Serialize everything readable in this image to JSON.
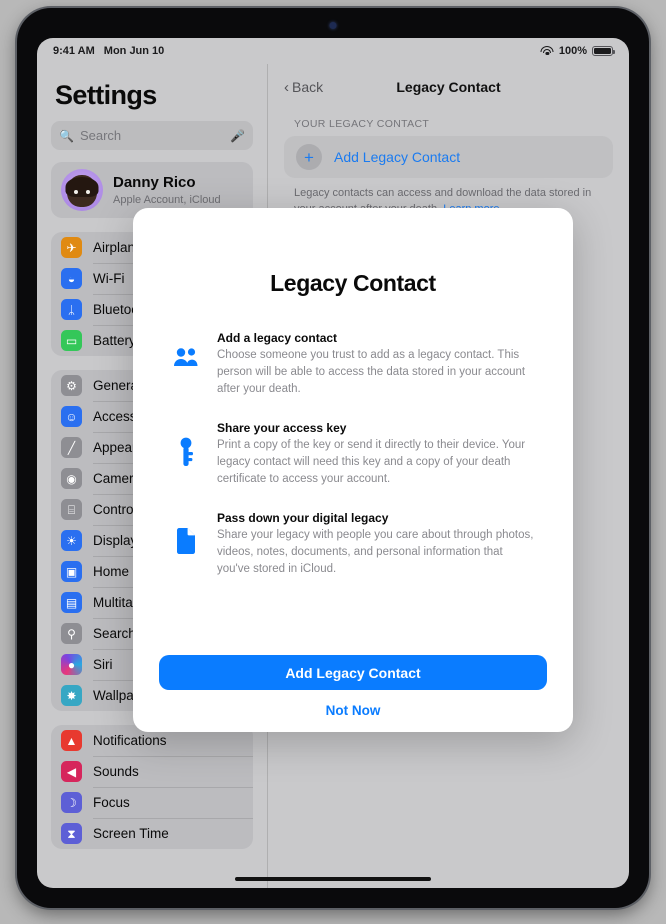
{
  "status_bar": {
    "time": "9:41 AM",
    "date": "Mon Jun 10",
    "wifi_icon": "wifi-icon",
    "battery_percent": "100%",
    "battery_icon": "battery-full-icon"
  },
  "sidebar": {
    "title": "Settings",
    "search": {
      "placeholder": "Search",
      "icon": "search-icon",
      "mic_icon": "microphone-icon"
    },
    "account": {
      "name": "Danny Rico",
      "subtitle": "Apple Account, iCloud",
      "avatar": "memoji-avatar"
    },
    "groups": [
      {
        "items": [
          {
            "label": "Airplane Mode",
            "icon": "airplane-icon",
            "color": "#e08a12"
          },
          {
            "label": "Wi-Fi",
            "icon": "wifi-icon",
            "color": "#2a6ff0"
          },
          {
            "label": "Bluetooth",
            "icon": "bluetooth-icon",
            "color": "#2a6ff0"
          },
          {
            "label": "Battery",
            "icon": "battery-icon",
            "color": "#34c759"
          }
        ]
      },
      {
        "items": [
          {
            "label": "General",
            "icon": "gear-icon",
            "color": "#8e8e93"
          },
          {
            "label": "Accessibility",
            "icon": "accessibility-icon",
            "color": "#2a6ff0"
          },
          {
            "label": "Appearance",
            "icon": "appearance-icon",
            "color": "#8e8e93"
          },
          {
            "label": "Camera",
            "icon": "camera-icon",
            "color": "#8e8e93"
          },
          {
            "label": "Control Center",
            "icon": "control-center-icon",
            "color": "#8e8e93"
          },
          {
            "label": "Display & Brightness",
            "icon": "brightness-icon",
            "color": "#2a6ff0"
          },
          {
            "label": "Home Screen & App Library",
            "icon": "home-screen-icon",
            "color": "#2a6ff0"
          },
          {
            "label": "Multitasking & Gestures",
            "icon": "multitasking-icon",
            "color": "#2a6ff0"
          },
          {
            "label": "Search",
            "icon": "search-icon",
            "color": "#8e8e93"
          },
          {
            "label": "Siri",
            "icon": "siri-icon",
            "color": "#2b2b35"
          },
          {
            "label": "Wallpaper",
            "icon": "wallpaper-icon",
            "color": "#37a7c4"
          }
        ]
      },
      {
        "items": [
          {
            "label": "Notifications",
            "icon": "bell-icon",
            "color": "#e8392f"
          },
          {
            "label": "Sounds",
            "icon": "speaker-icon",
            "color": "#d6265c"
          },
          {
            "label": "Focus",
            "icon": "moon-icon",
            "color": "#5d5fd6"
          },
          {
            "label": "Screen Time",
            "icon": "hourglass-icon",
            "color": "#5d5fd6"
          }
        ]
      }
    ]
  },
  "detail": {
    "back_label": "Back",
    "back_icon": "chevron-left-icon",
    "title": "Legacy Contact",
    "section_header": "YOUR LEGACY CONTACT",
    "add_row": {
      "label": "Add Legacy Contact",
      "icon": "plus-icon"
    },
    "footnote": "Legacy contacts can access and download the data stored in your account after your death.",
    "footnote_link": "Learn more..."
  },
  "modal": {
    "title": "Legacy Contact",
    "features": [
      {
        "icon": "two-people-icon",
        "heading": "Add a legacy contact",
        "body": "Choose someone you trust to add as a legacy contact. This person will be able to access the data stored in your account after your death."
      },
      {
        "icon": "key-icon",
        "heading": "Share your access key",
        "body": "Print a copy of the key or send it directly to their device. Your legacy contact will need this key and a copy of your death certificate to access your account."
      },
      {
        "icon": "document-icon",
        "heading": "Pass down your digital legacy",
        "body": "Share your legacy with people you care about through photos, videos, notes, documents, and personal information that you've stored in iCloud."
      }
    ],
    "primary_button": "Add Legacy Contact",
    "secondary_button": "Not Now"
  },
  "colors": {
    "accent": "#0a7cff",
    "link": "#1b7bf0"
  }
}
